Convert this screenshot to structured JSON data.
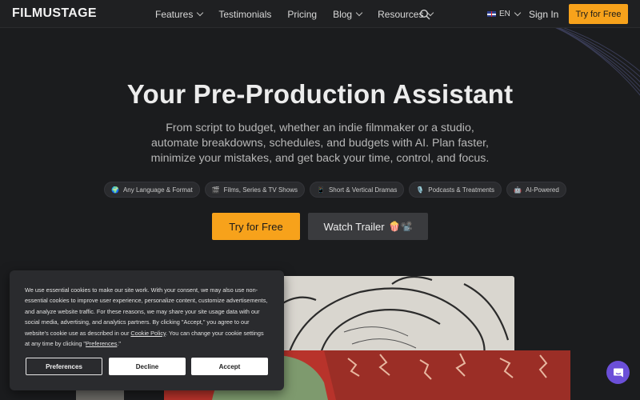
{
  "brand": {
    "logo_text": "FILMUSTAGE",
    "accent": "#f7a21b"
  },
  "header": {
    "nav": [
      {
        "label": "Features",
        "has_dropdown": true
      },
      {
        "label": "Testimonials",
        "has_dropdown": false
      },
      {
        "label": "Pricing",
        "has_dropdown": false
      },
      {
        "label": "Blog",
        "has_dropdown": true
      },
      {
        "label": "Resources",
        "has_dropdown": true
      }
    ],
    "search_icon": "search-icon",
    "language": "EN",
    "sign_in": "Sign In",
    "cta": "Try for Free"
  },
  "hero": {
    "title": "Your Pre-Production Assistant",
    "subtitle": "From script to budget, whether an indie filmmaker or a studio, automate breakdowns, schedules, and budgets with AI. Plan faster, minimize your mistakes, and get back your time, control, and focus.",
    "pills": [
      {
        "emoji": "🌍",
        "label": "Any Language & Format"
      },
      {
        "emoji": "🎬",
        "label": "Films, Series & TV Shows"
      },
      {
        "emoji": "📱",
        "label": "Short & Vertical Dramas"
      },
      {
        "emoji": "🎙️",
        "label": "Podcasts & Treatments"
      },
      {
        "emoji": "🤖",
        "label": "AI-Powered"
      }
    ],
    "primary_button": "Try for Free",
    "secondary_button": "Watch Trailer",
    "secondary_button_emoji": "🍿📽️"
  },
  "cookie_banner": {
    "text_before_link": "We use essential cookies to make our site work. With your consent, we may also use non-essential cookies to improve user experience, personalize content, customize advertisements, and analyze website traffic. For these reasons, we may share your site usage data with our social media, advertising, and analytics partners. By clicking \"Accept,\" you agree to our website's cookie use as described in our ",
    "link1": "Cookie Policy",
    "text_middle": ". You can change your cookie settings at any time by clicking \"",
    "link2": "Preferences",
    "text_after": ".\"",
    "preferences_button": "Preferences",
    "decline_button": "Decline",
    "accept_button": "Accept"
  },
  "chat_widget": {
    "icon": "chat-bubble-icon",
    "color": "#6b4fd8"
  }
}
